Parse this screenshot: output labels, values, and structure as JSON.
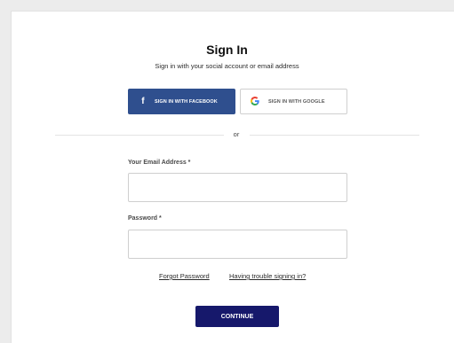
{
  "header": {
    "title": "Sign In",
    "subtitle": "Sign in with your social account or email address"
  },
  "social": {
    "facebook_label": "SIGN IN WITH FACEBOOK",
    "google_label": "SIGN IN WITH GOOGLE",
    "facebook_icon": "facebook-icon",
    "google_icon": "google-icon"
  },
  "divider": {
    "text": "or"
  },
  "form": {
    "email_label": "Your Email Address *",
    "email_value": "",
    "password_label": "Password *",
    "password_value": ""
  },
  "links": {
    "forgot": "Forgot Password",
    "trouble": "Having trouble signing in?"
  },
  "actions": {
    "continue_label": "CONTINUE"
  },
  "colors": {
    "facebook": "#2f4f8e",
    "continue": "#16186b",
    "background_gray": "#ececec"
  }
}
